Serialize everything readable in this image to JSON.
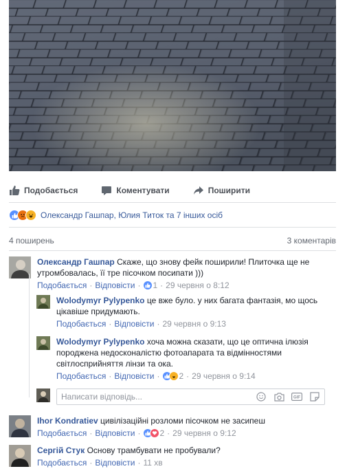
{
  "actions": {
    "like_label": "Подобається",
    "comment_label": "Коментувати",
    "share_label": "Поширити"
  },
  "reactions": {
    "icons": [
      "like-icon",
      "angry-icon",
      "haha-icon"
    ],
    "names": "Олександр Гашпар, Юлия Титок та 7 інших осіб"
  },
  "counts": {
    "shares": "4 поширень",
    "comments": "3 коментарів"
  },
  "comments": [
    {
      "name": "Олександр Гашпар",
      "text": "Скаже, що знову фейк поширили! Плиточка ще не утромбовалась, її тре пісочком посипати )))",
      "like_label": "Подобається",
      "reply_label": "Відповісти",
      "reaction_count": "1",
      "time": "29 червня о 8:12",
      "replies": [
        {
          "name": "Wolodymyr Pylypenko",
          "text": "це вже було. у них багата фантазія, мо щось цікавіше придумають.",
          "like_label": "Подобається",
          "reply_label": "Відповісти",
          "time": "29 червня о 9:13"
        },
        {
          "name": "Wolodymyr Pylypenko",
          "text": "хоча можна сказати, що це оптична ілюзія породжена недосконалістю фотоапарата та відмінностями світлосприйняття лінзи та ока.",
          "like_label": "Подобається",
          "reply_label": "Відповісти",
          "reaction_count": "2",
          "time": "29 червня о 9:14"
        }
      ]
    },
    {
      "name": "Ihor Kondratiev",
      "text": "цивілізаційні розломи пісочком не засипеш",
      "like_label": "Подобається",
      "reply_label": "Відповісти",
      "reaction_count": "2",
      "time": "29 червня о 9:12"
    },
    {
      "name": "Сергій Стук",
      "text": "Основу трамбувати не пробували?",
      "like_label": "Подобається",
      "reply_label": "Відповісти",
      "time": "11 хв"
    }
  ],
  "reply_box": {
    "placeholder": "Написати відповідь..."
  },
  "colors": {
    "link": "#365899",
    "meta": "#90949c",
    "like_blue": "#5890ff"
  }
}
